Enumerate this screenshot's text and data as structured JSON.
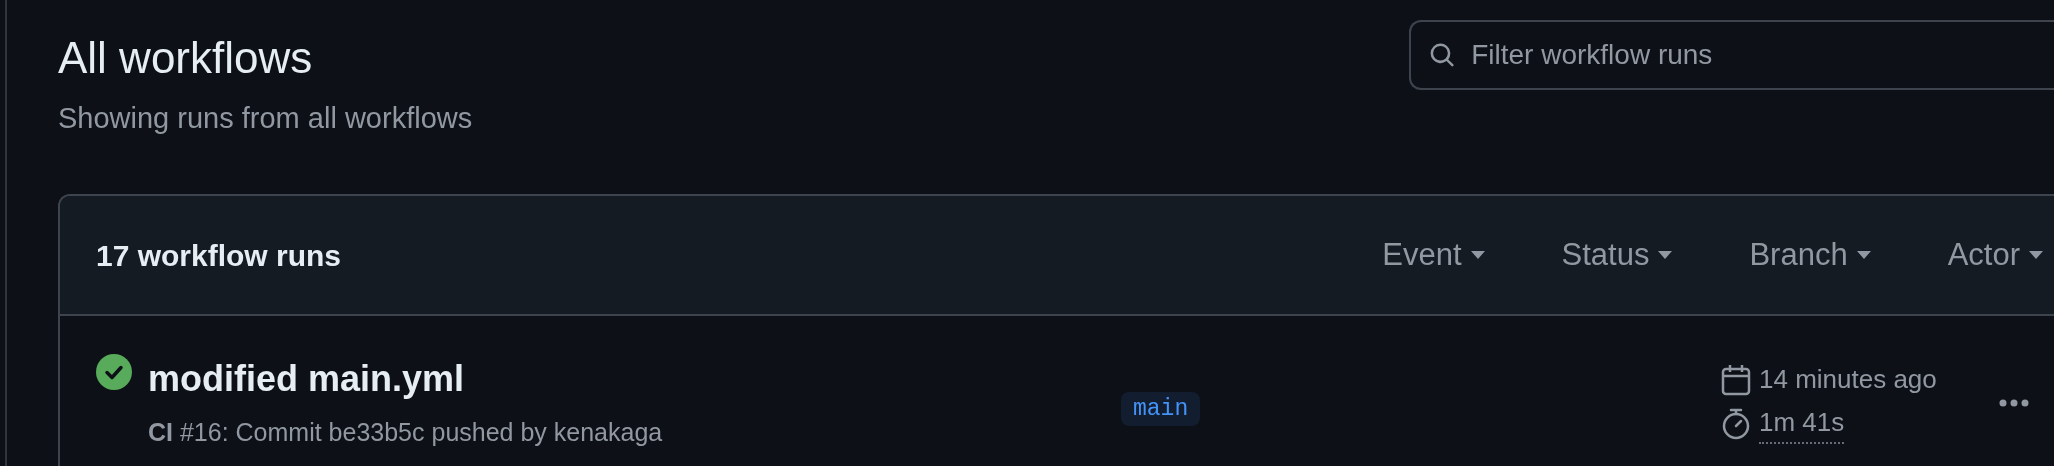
{
  "header": {
    "title": "All workflows",
    "subtitle": "Showing runs from all workflows"
  },
  "search": {
    "placeholder": "Filter workflow runs"
  },
  "runs_panel": {
    "count": "17 workflow runs",
    "filters": [
      {
        "label": "Event"
      },
      {
        "label": "Status"
      },
      {
        "label": "Branch"
      },
      {
        "label": "Actor"
      }
    ],
    "runs": [
      {
        "kind": "success",
        "title": "modified main.yml",
        "detail": "**CI** #16: Commit be33b5c pushed by kenakaga",
        "branch": "main",
        "started": "14 minutes ago",
        "duration": "1m 41s"
      }
    ]
  }
}
